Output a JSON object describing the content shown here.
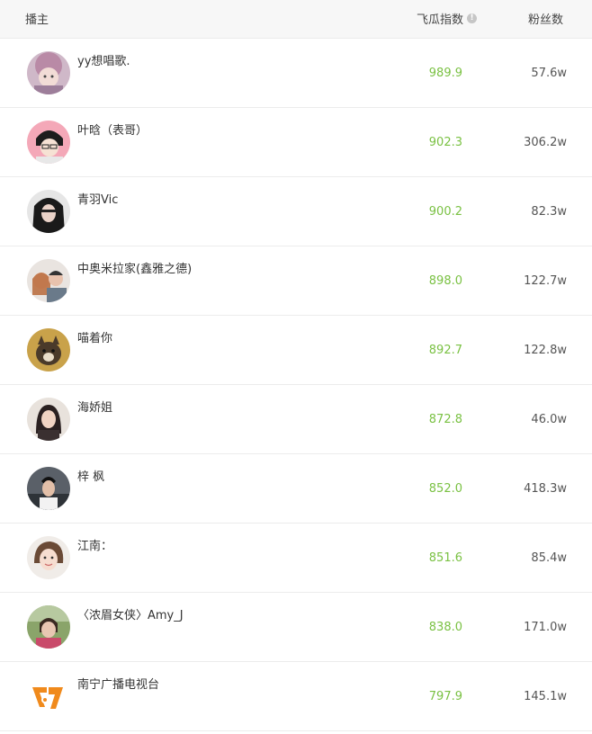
{
  "header": {
    "col_name": "播主",
    "col_index": "飞瓜指数",
    "col_index_info_icon": "info-circle-icon",
    "col_fans": "粉丝数"
  },
  "colors": {
    "index_value": "#7ac143",
    "header_bg": "#f7f7f7",
    "divider": "#ececec"
  },
  "rows": [
    {
      "name": "yy想唱歌.",
      "index": "989.9",
      "fans": "57.6w",
      "avatar": "avatar-girl-hat"
    },
    {
      "name": "叶晗（表哥）",
      "index": "902.3",
      "fans": "306.2w",
      "avatar": "avatar-anime-boy"
    },
    {
      "name": "青羽Vic",
      "index": "900.2",
      "fans": "82.3w",
      "avatar": "avatar-dark-hair"
    },
    {
      "name": "中奥米拉家(鑫雅之德)",
      "index": "898.0",
      "fans": "122.7w",
      "avatar": "avatar-couple"
    },
    {
      "name": "喵着你",
      "index": "892.7",
      "fans": "122.8w",
      "avatar": "avatar-cat"
    },
    {
      "name": "海娇姐",
      "index": "872.8",
      "fans": "46.0w",
      "avatar": "avatar-woman"
    },
    {
      "name": "梓 枫",
      "index": "852.0",
      "fans": "418.3w",
      "avatar": "avatar-man-car"
    },
    {
      "name": "江南：",
      "index": "851.6",
      "fans": "85.4w",
      "avatar": "avatar-woman-selfie"
    },
    {
      "name": "〈浓眉女侠〉Amy_J",
      "index": "838.0",
      "fans": "171.0w",
      "avatar": "avatar-woman-outdoor"
    },
    {
      "name": "南宁广播电视台",
      "index": "797.9",
      "fans": "145.1w",
      "avatar": "avatar-station-logo"
    }
  ]
}
